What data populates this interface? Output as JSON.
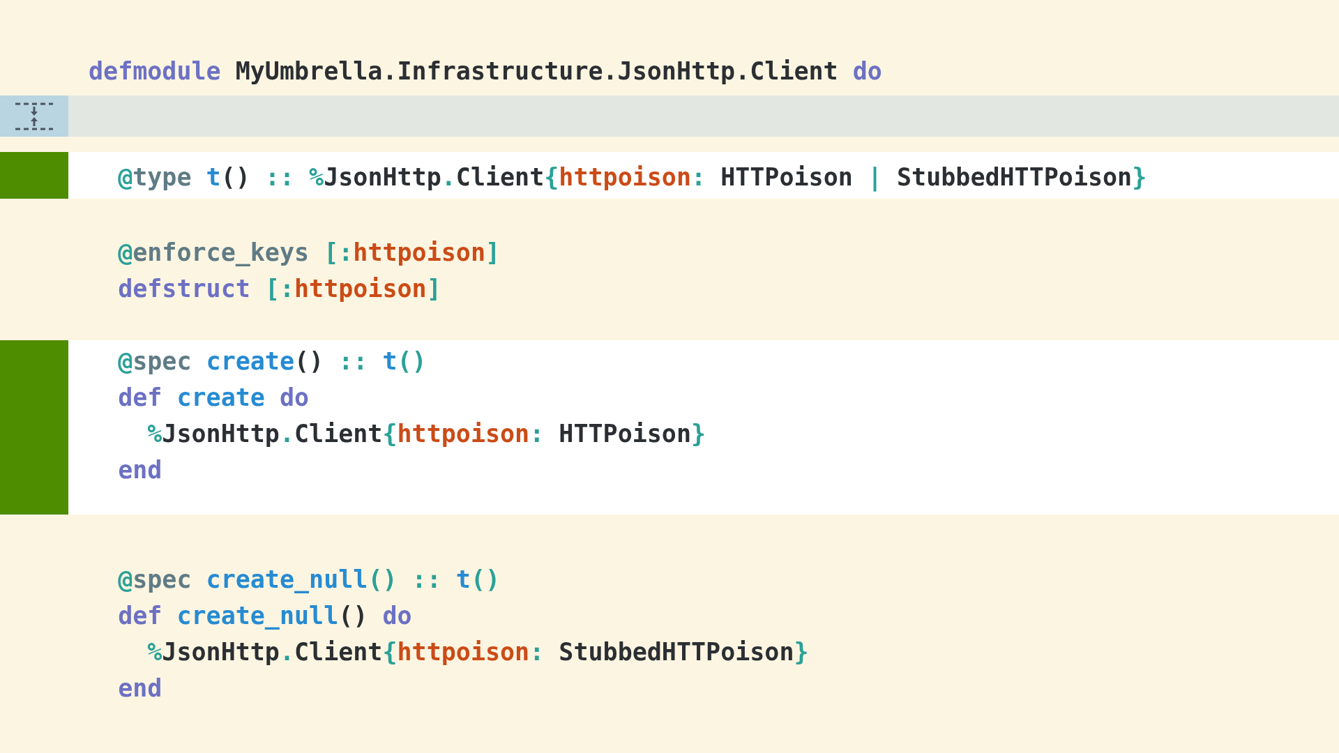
{
  "blocks": [
    {
      "kind": "plain",
      "lines": [
        [
          {
            "kind": "kw",
            "text": "defmodule"
          },
          {
            "kind": "text",
            "text": " MyUmbrella.Infrastructure.JsonHttp.Client "
          },
          {
            "kind": "kw",
            "text": "do"
          }
        ]
      ]
    },
    {
      "kind": "collapsed"
    },
    {
      "kind": "added",
      "lines": [
        [
          {
            "kind": "at",
            "text": "  @"
          },
          {
            "kind": "attr",
            "text": "type "
          },
          {
            "kind": "fn",
            "text": "t"
          },
          {
            "kind": "text",
            "text": "() "
          },
          {
            "kind": "op",
            "text": ":: %"
          },
          {
            "kind": "text",
            "text": "JsonHttp"
          },
          {
            "kind": "op",
            "text": "."
          },
          {
            "kind": "text",
            "text": "Client"
          },
          {
            "kind": "op",
            "text": "{"
          },
          {
            "kind": "atom",
            "text": "httpoison"
          },
          {
            "kind": "op",
            "text": ": "
          },
          {
            "kind": "text",
            "text": "HTTPoison "
          },
          {
            "kind": "op",
            "text": "| "
          },
          {
            "kind": "text",
            "text": "StubbedHTTPoison"
          },
          {
            "kind": "op",
            "text": "}"
          }
        ]
      ]
    },
    {
      "kind": "plain",
      "lines": [
        [
          {
            "kind": "at",
            "text": "  @"
          },
          {
            "kind": "attr",
            "text": "enforce_keys "
          },
          {
            "kind": "op",
            "text": "[:"
          },
          {
            "kind": "atom",
            "text": "httpoison"
          },
          {
            "kind": "op",
            "text": "]"
          }
        ],
        [
          {
            "kind": "kw",
            "text": "  defstruct "
          },
          {
            "kind": "op",
            "text": "[:"
          },
          {
            "kind": "atom",
            "text": "httpoison"
          },
          {
            "kind": "op",
            "text": "]"
          }
        ]
      ]
    },
    {
      "kind": "added",
      "lines": [
        [
          {
            "kind": "at",
            "text": "  @"
          },
          {
            "kind": "attr",
            "text": "spec "
          },
          {
            "kind": "fn",
            "text": "create"
          },
          {
            "kind": "text",
            "text": "() "
          },
          {
            "kind": "op",
            "text": ":: "
          },
          {
            "kind": "fn",
            "text": "t"
          },
          {
            "kind": "op",
            "text": "()"
          }
        ],
        [
          {
            "kind": "kw",
            "text": "  def "
          },
          {
            "kind": "fn",
            "text": "create "
          },
          {
            "kind": "kw",
            "text": "do"
          }
        ],
        [
          {
            "kind": "op",
            "text": "    %"
          },
          {
            "kind": "text",
            "text": "JsonHttp"
          },
          {
            "kind": "op",
            "text": "."
          },
          {
            "kind": "text",
            "text": "Client"
          },
          {
            "kind": "op",
            "text": "{"
          },
          {
            "kind": "atom",
            "text": "httpoison"
          },
          {
            "kind": "op",
            "text": ": "
          },
          {
            "kind": "text",
            "text": "HTTPoison"
          },
          {
            "kind": "op",
            "text": "}"
          }
        ],
        [
          {
            "kind": "kw",
            "text": "  end"
          }
        ]
      ]
    },
    {
      "kind": "plain",
      "lines": [
        [
          {
            "kind": "at",
            "text": "  @"
          },
          {
            "kind": "attr",
            "text": "spec "
          },
          {
            "kind": "fn",
            "text": "create_null"
          },
          {
            "kind": "op",
            "text": "() :: "
          },
          {
            "kind": "fn",
            "text": "t"
          },
          {
            "kind": "op",
            "text": "()"
          }
        ],
        [
          {
            "kind": "kw",
            "text": "  def "
          },
          {
            "kind": "fn",
            "text": "create_null"
          },
          {
            "kind": "text",
            "text": "() "
          },
          {
            "kind": "kw",
            "text": "do"
          }
        ],
        [
          {
            "kind": "op",
            "text": "    %"
          },
          {
            "kind": "text",
            "text": "JsonHttp"
          },
          {
            "kind": "op",
            "text": "."
          },
          {
            "kind": "text",
            "text": "Client"
          },
          {
            "kind": "op",
            "text": "{"
          },
          {
            "kind": "atom",
            "text": "httpoison"
          },
          {
            "kind": "op",
            "text": ": "
          },
          {
            "kind": "text",
            "text": "StubbedHTTPoison"
          },
          {
            "kind": "op",
            "text": "}"
          }
        ],
        [
          {
            "kind": "kw",
            "text": "  end"
          }
        ]
      ]
    }
  ]
}
